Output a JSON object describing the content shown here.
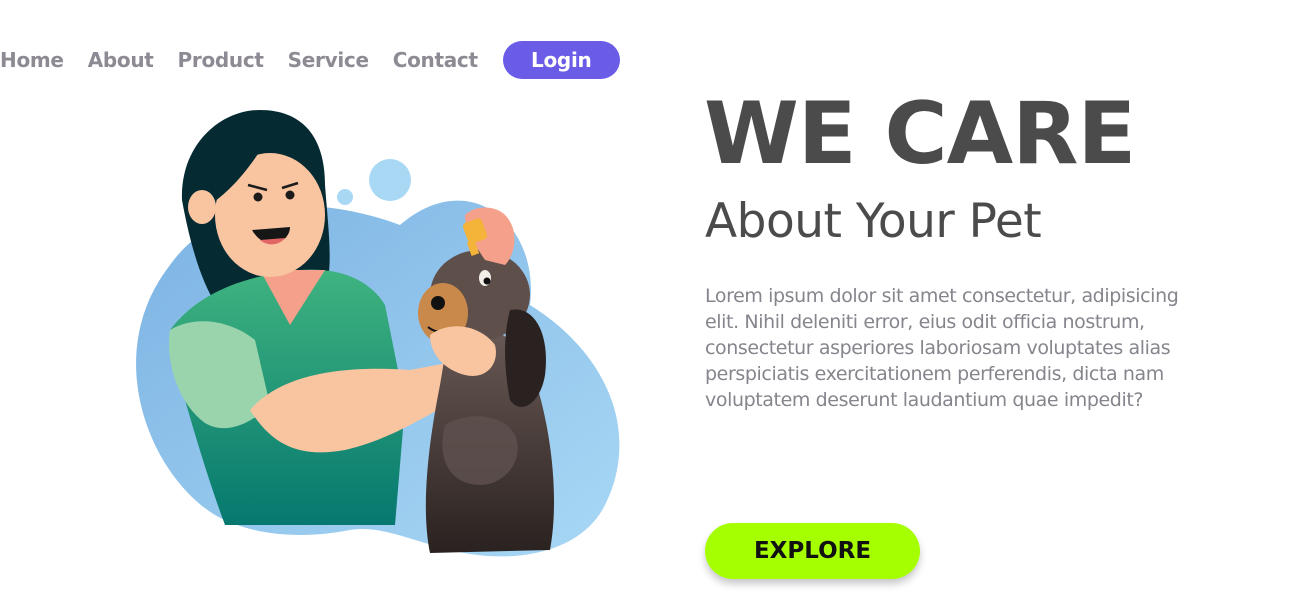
{
  "nav": {
    "links": [
      {
        "label": "Home"
      },
      {
        "label": "About"
      },
      {
        "label": "Product"
      },
      {
        "label": "Service"
      },
      {
        "label": "Contact"
      }
    ],
    "login_label": "Login"
  },
  "hero": {
    "title": "WE CARE",
    "subtitle": "About Your Pet",
    "body": "Lorem ipsum dolor sit amet consectetur, adipisicing elit. Nihil deleniti error, eius odit officia nostrum, consectetur asperiores laboriosam voluptates alias perspiciatis exercitationem perferendis, dicta nam voluptatem deserunt laudantium quae impedit?",
    "cta_label": "EXPLORE"
  },
  "illustration": {
    "icon": "woman-with-dog-illustration"
  },
  "colors": {
    "login_bg": "#6b5ce7",
    "cta_bg": "#a6ff00",
    "title": "#4b4b4b",
    "nav_text": "#8d8a93",
    "body_text": "#86848c"
  }
}
